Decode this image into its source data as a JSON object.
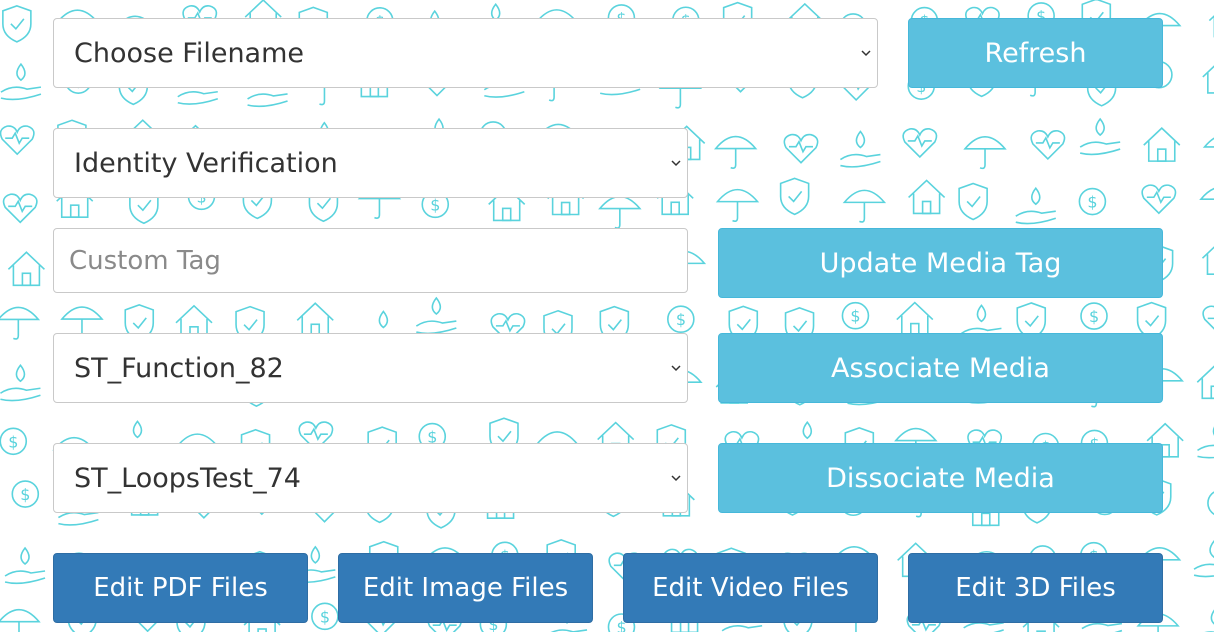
{
  "colors": {
    "pattern": "#5ad3dd",
    "info_button": "#5bc0de",
    "primary_button": "#337ab7"
  },
  "filename_select": {
    "value": "Choose Filename"
  },
  "refresh_button": {
    "label": "Refresh"
  },
  "tag_select": {
    "value": "Identity Verification"
  },
  "custom_tag_input": {
    "placeholder": "Custom Tag",
    "value": ""
  },
  "update_media_tag_button": {
    "label": "Update Media Tag"
  },
  "function_select": {
    "value": "ST_Function_82"
  },
  "associate_media_button": {
    "label": "Associate Media"
  },
  "test_select": {
    "value": "ST_LoopsTest_74"
  },
  "dissociate_media_button": {
    "label": "Dissociate Media"
  },
  "edit_buttons": {
    "pdf": "Edit PDF Files",
    "image": "Edit Image Files",
    "video": "Edit Video Files",
    "threed": "Edit 3D Files"
  }
}
